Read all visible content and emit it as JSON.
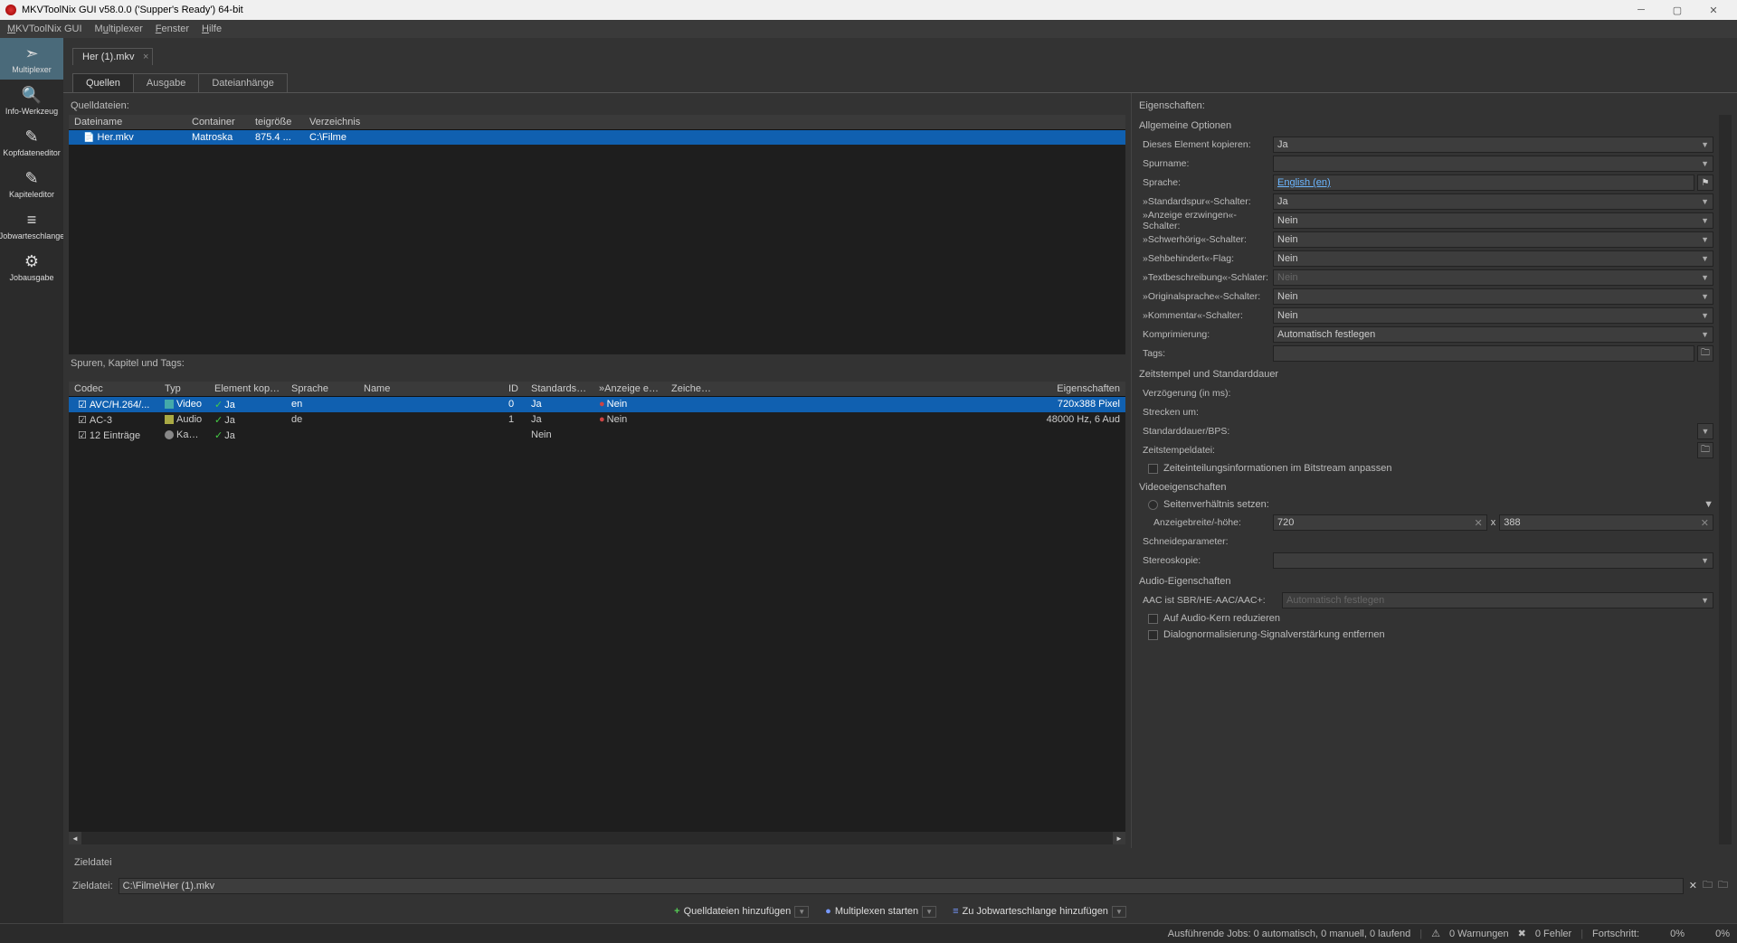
{
  "title": "MKVToolNix GUI v58.0.0 ('Supper's Ready') 64-bit",
  "menubar": [
    "MKVToolNix GUI",
    "Multiplexer",
    "Fenster",
    "Hilfe"
  ],
  "sidebar": [
    {
      "label": "Multiplexer",
      "active": true
    },
    {
      "label": "Info-Werkzeug"
    },
    {
      "label": "Kopfdateneditor"
    },
    {
      "label": "Kapiteleditor"
    },
    {
      "label": "Jobwarteschlange"
    },
    {
      "label": "Jobausgabe"
    }
  ],
  "filetab": "Her (1).mkv",
  "subtabs": [
    "Quellen",
    "Ausgabe",
    "Dateianhänge"
  ],
  "sources": {
    "label": "Quelldateien:",
    "headers": [
      "Dateiname",
      "Container",
      "teigröße",
      "Verzeichnis"
    ],
    "rows": [
      {
        "name": "Her.mkv",
        "container": "Matroska",
        "size": "875.4 ...",
        "dir": "C:\\Filme"
      }
    ]
  },
  "tracks": {
    "label": "Spuren, Kapitel und Tags:",
    "headers": [
      "Codec",
      "Typ",
      "Element kopieren",
      "Sprache",
      "Name",
      "ID",
      "Standardspur",
      "»Anzeige erzwingen«",
      "Zeichensatz",
      "Eigenschaften"
    ],
    "rows": [
      {
        "codec": "AVC/H.264/...",
        "typ": "Video",
        "copy": "Ja",
        "lang": "en",
        "name": "",
        "id": "0",
        "def": "Ja",
        "force": "Nein",
        "charset": "",
        "props": "720x388 Pixel",
        "sel": true,
        "typclass": "typ-video"
      },
      {
        "codec": "AC-3",
        "typ": "Audio",
        "copy": "Ja",
        "lang": "de",
        "name": "",
        "id": "1",
        "def": "Ja",
        "force": "Nein",
        "charset": "",
        "props": "48000 Hz, 6 Aud",
        "typclass": "typ-audio"
      },
      {
        "codec": "12 Einträge",
        "typ": "Kapitel",
        "copy": "Ja",
        "lang": "",
        "name": "",
        "id": "",
        "def": "Nein",
        "force": "",
        "charset": "",
        "props": "",
        "typclass": "typ-chapter"
      }
    ]
  },
  "props": {
    "label": "Eigenschaften:",
    "general": {
      "header": "Allgemeine Optionen",
      "copy_element": {
        "lbl": "Dieses Element kopieren:",
        "val": "Ja"
      },
      "track_name": {
        "lbl": "Spurname:",
        "val": ""
      },
      "language": {
        "lbl": "Sprache:",
        "val": "English (en)"
      },
      "default_track": {
        "lbl": "»Standardspur«-Schalter:",
        "val": "Ja"
      },
      "forced": {
        "lbl": "»Anzeige erzwingen«-Schalter:",
        "val": "Nein"
      },
      "hearing": {
        "lbl": "»Schwerhörig«-Schalter:",
        "val": "Nein"
      },
      "visual": {
        "lbl": "»Sehbehindert«-Flag:",
        "val": "Nein"
      },
      "textdesc": {
        "lbl": "»Textbeschreibung«-Schlater:",
        "val": "Nein"
      },
      "origlang": {
        "lbl": "»Originalsprache«-Schalter:",
        "val": "Nein"
      },
      "comment": {
        "lbl": "»Kommentar«-Schalter:",
        "val": "Nein"
      },
      "compression": {
        "lbl": "Komprimierung:",
        "val": "Automatisch festlegen"
      },
      "tags": {
        "lbl": "Tags:",
        "val": ""
      }
    },
    "timing": {
      "header": "Zeitstempel und Standarddauer",
      "delay": {
        "lbl": "Verzögerung (in ms):",
        "val": ""
      },
      "stretch": {
        "lbl": "Strecken um:",
        "val": ""
      },
      "default_dur": {
        "lbl": "Standarddauer/BPS:",
        "val": ""
      },
      "timestamp_file": {
        "lbl": "Zeitstempeldatei:",
        "val": ""
      },
      "bitstream_check": "Zeiteinteilungsinformationen im Bitstream anpassen"
    },
    "video": {
      "header": "Videoeigenschaften",
      "aspect_set": "Seitenverhältnis setzen:",
      "dimensions": {
        "lbl": "Anzeigebreite/-höhe:",
        "w": "720",
        "h": "388",
        "x": "x"
      },
      "crop": {
        "lbl": "Schneideparameter:",
        "val": ""
      },
      "stereo": {
        "lbl": "Stereoskopie:",
        "val": ""
      }
    },
    "audio": {
      "header": "Audio-Eigenschaften",
      "aac": {
        "lbl": "AAC ist SBR/HE-AAC/AAC+:",
        "val": "Automatisch festlegen"
      },
      "reduce_core": "Auf Audio-Kern reduzieren",
      "dialnorm": "Dialognormalisierung-Signalverstärkung entfernen"
    }
  },
  "dest": {
    "section": "Zieldatei",
    "label": "Zieldatei:",
    "value": "C:\\Filme\\Her (1).mkv"
  },
  "bottom_buttons": {
    "add_sources": "Quelldateien hinzufügen",
    "start_mux": "Multiplexen starten",
    "add_queue": "Zu Jobwarteschlange hinzufügen"
  },
  "status": {
    "jobs": "Ausführende Jobs: 0 automatisch, 0 manuell, 0 laufend",
    "warnings": "0 Warnungen",
    "errors": "0 Fehler",
    "progress_lbl": "Fortschritt:",
    "p1": "0%",
    "p2": "0%"
  }
}
